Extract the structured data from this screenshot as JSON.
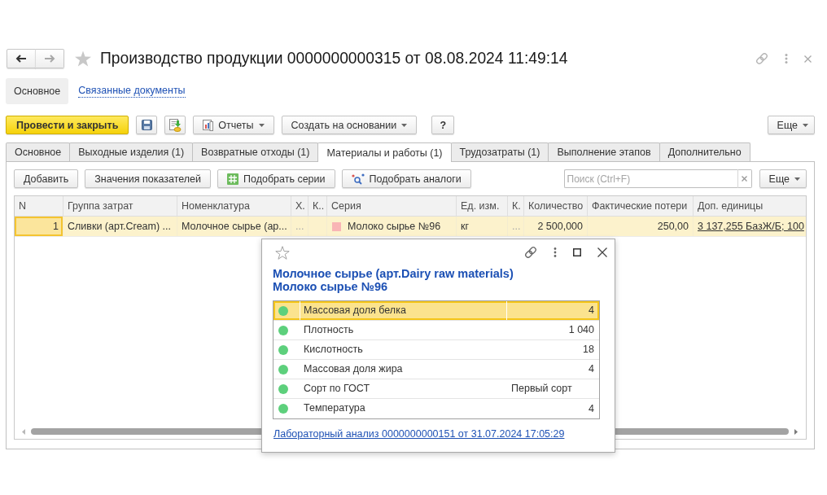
{
  "window": {
    "title": "Производство продукции 0000000000315 от 08.08.2024 11:49:14"
  },
  "navigation": [
    {
      "kind": "back",
      "disabled": false
    },
    {
      "kind": "forward",
      "disabled": true
    }
  ],
  "form_sections": [
    {
      "label": "Основное",
      "selected": true
    },
    {
      "label": "Связанные документы",
      "selected": false
    }
  ],
  "command_bar": {
    "post_and_close": "Провести и закрыть",
    "reports": "Отчеты",
    "create_based_on": "Создать на основании",
    "help": "?",
    "more": "Еще"
  },
  "tabs": [
    {
      "label": "Основное",
      "selected": false
    },
    {
      "label": "Выходные изделия (1)",
      "selected": false
    },
    {
      "label": "Возвратные отходы (1)",
      "selected": false
    },
    {
      "label": "Материалы и работы (1)",
      "selected": true
    },
    {
      "label": "Трудозатраты (1)",
      "selected": false
    },
    {
      "label": "Выполнение этапов",
      "selected": false
    },
    {
      "label": "Дополнительно",
      "selected": false
    }
  ],
  "table_toolbar": {
    "buttons": [
      "Добавить",
      "Значения показателей",
      "Подобрать серии",
      "Подобрать аналоги"
    ],
    "search": {
      "placeholder": "Поиск (Ctrl+F)"
    },
    "more": "Еще"
  },
  "table": {
    "columns": [
      "N",
      "Группа затрат",
      "Номенклатура",
      "Х.",
      "К..",
      "Серия",
      "Ед. изм.",
      "К.",
      "Количество",
      "Фактические потери",
      "Доп. единицы"
    ],
    "rows": [
      {
        "selected": true,
        "n": "1",
        "cost_group": "Сливки (арт.Cream) ...",
        "item": "Молочное сырье (ар...",
        "column_4": "...",
        "series": "Молоко сырье №96",
        "color": "#f9b5b5",
        "unit": "кг",
        "column_8": "...",
        "quantity": "2 500,000",
        "actual_losses": "250,00",
        "extra_units": "3 137,255 БазЖ/Б; 100"
      }
    ]
  },
  "popup": {
    "title_lines": [
      "Молочное сырье (арт.Dairy raw materials)",
      "Молоко сырье №96"
    ],
    "indicators": [
      {
        "name": "Массовая доля белка",
        "value": "4",
        "kind": "number",
        "selected": true
      },
      {
        "name": "Плотность",
        "value": "1 040",
        "kind": "number",
        "selected": false
      },
      {
        "name": "Кислотность",
        "value": "18",
        "kind": "number",
        "selected": false
      },
      {
        "name": "Массовая доля жира",
        "value": "4",
        "kind": "number",
        "selected": false
      },
      {
        "name": "Сорт по ГОСТ",
        "value": "Первый сорт",
        "kind": "text",
        "selected": false
      },
      {
        "name": "Температура",
        "value": "4",
        "kind": "number",
        "selected": false
      }
    ],
    "link": "Лабораторный анализ 0000000000151 от 31.07.2024 17:05:29"
  }
}
